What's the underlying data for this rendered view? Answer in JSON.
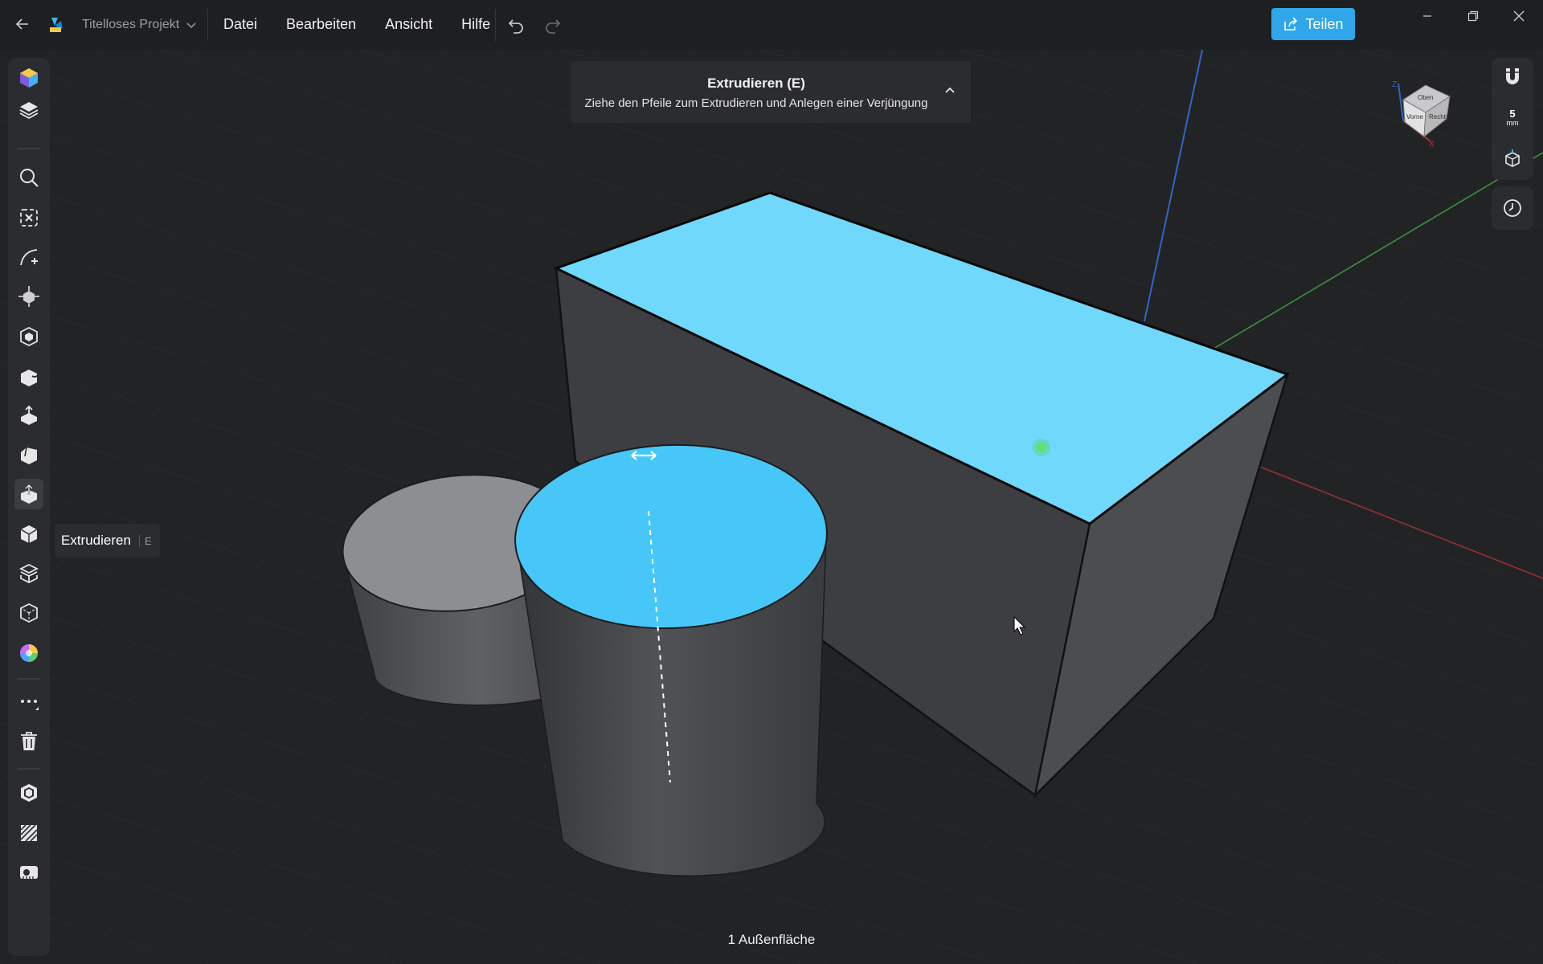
{
  "app": {
    "project_name": "Titelloses Projekt",
    "menu": [
      "Datei",
      "Bearbeiten",
      "Ansicht",
      "Hilfe"
    ],
    "share_label": "Teilen"
  },
  "hint": {
    "title": "Extrudieren (E)",
    "description": "Ziehe den Pfeile zum Extrudieren und Anlegen einer Verjüngung"
  },
  "tooltip": {
    "label": "Extrudieren",
    "key": "E"
  },
  "right_panel": {
    "grid_value": "5",
    "grid_unit": "mm"
  },
  "nav_cube": {
    "faces": [
      "Oben",
      "Vorne",
      "Rechts"
    ],
    "axes": [
      "Z",
      "X"
    ]
  },
  "status": {
    "selection": "1 Außenfläche"
  },
  "colors": {
    "selection": "#6fd8fb",
    "accent": "#2fa7ea",
    "body_dark": "#3d3e41",
    "body_light": "#8d8e92"
  },
  "icons": {
    "left_toolbar": [
      "materials-icon",
      "layers-icon",
      "search-icon",
      "deselect-icon",
      "sketch-icon",
      "move-icon",
      "primitives-icon",
      "push-pull-icon",
      "extrude-up-icon",
      "chamfer-icon",
      "extrude-icon",
      "solid-icon",
      "offset-icon",
      "shell-icon",
      "color-icon",
      "more-icon",
      "trash-icon",
      "render-icon",
      "texture-icon",
      "measure-icon"
    ],
    "right_toolbar": [
      "magnet-icon",
      "grid-size-icon",
      "view-icon",
      "history-icon"
    ]
  }
}
